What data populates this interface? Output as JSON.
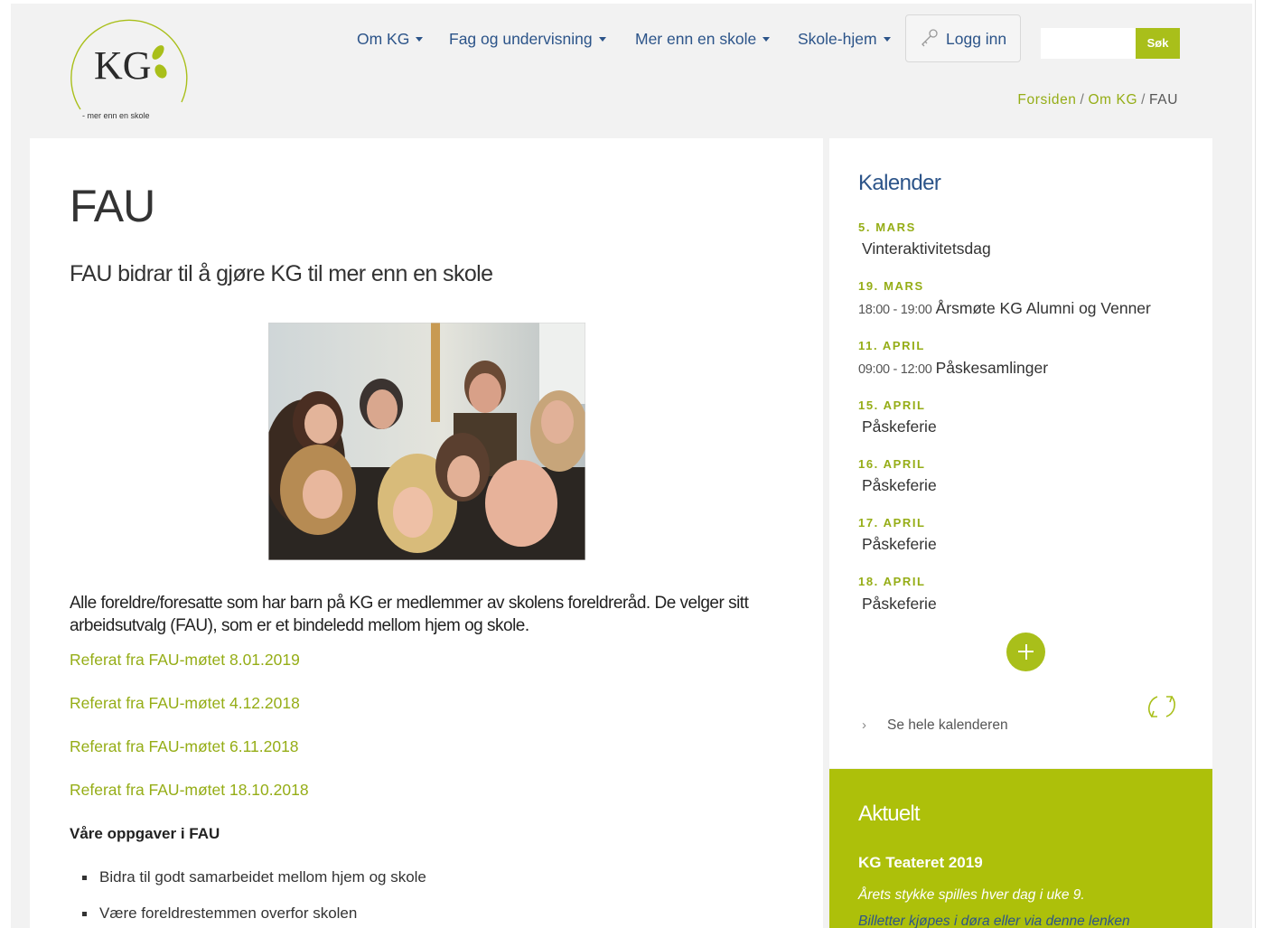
{
  "header": {
    "logo": {
      "letters": "KG",
      "tagline": "- mer enn en skole"
    },
    "nav": [
      {
        "label": "Om KG"
      },
      {
        "label": "Fag og undervisning"
      },
      {
        "label": "Mer enn en skole"
      },
      {
        "label": "Skole-hjem"
      }
    ],
    "login_label": "Logg inn",
    "search": {
      "value": "",
      "button_label": "Søk"
    },
    "breadcrumb": {
      "home": "Forsiden",
      "section": "Om KG",
      "current": "FAU",
      "separator": "/"
    }
  },
  "main": {
    "title": "FAU",
    "lead": "FAU bidrar til å gjøre KG til mer enn en skole",
    "paragraph": "Alle foreldre/foresatte som har barn på KG er medlemmer av skolens foreldreråd. De velger sitt arbeidsutvalg (FAU), som er et bindeledd mellom hjem og skole.",
    "links": [
      "Referat fra FAU-møtet 8.01.2019",
      "Referat fra FAU-møtet 4.12.2018",
      "Referat fra FAU-møtet 6.11.2018",
      "Referat fra FAU-møtet 18.10.2018"
    ],
    "tasks_heading": "Våre oppgaver i FAU",
    "tasks": [
      "Bidra til godt samarbeidet mellom hjem og skole",
      "Være foreldrestemmen overfor skolen"
    ]
  },
  "calendar": {
    "title": "Kalender",
    "events": [
      {
        "date": "5. MARS",
        "time": "",
        "name": "Vinteraktivitetsdag"
      },
      {
        "date": "19. MARS",
        "time": "18:00 - 19:00",
        "name": "Årsmøte KG Alumni og Venner"
      },
      {
        "date": "11. APRIL",
        "time": "09:00 - 12:00",
        "name": "Påskesamlinger"
      },
      {
        "date": "15. APRIL",
        "time": "",
        "name": "Påskeferie"
      },
      {
        "date": "16. APRIL",
        "time": "",
        "name": "Påskeferie"
      },
      {
        "date": "17. APRIL",
        "time": "",
        "name": "Påskeferie"
      },
      {
        "date": "18. APRIL",
        "time": "",
        "name": "Påskeferie"
      }
    ],
    "see_all_label": "Se hele kalenderen"
  },
  "aktuelt": {
    "title": "Aktuelt",
    "headline": "KG Teateret 2019",
    "text": "Årets stykke spilles hver dag i uke 9.",
    "link_text": "Billetter kjøpes i døra eller via denne lenken"
  },
  "icons": {
    "nav_caret": "caret-down-icon",
    "login": "key-icon",
    "more": "plus-icon",
    "refresh": "refresh-icon",
    "see_all": "chevron-right-icon"
  },
  "colors": {
    "accent": "#a9bf1a",
    "link_green": "#95ad16",
    "nav_blue": "#2c5489",
    "page_bg": "#f2f2f2"
  }
}
